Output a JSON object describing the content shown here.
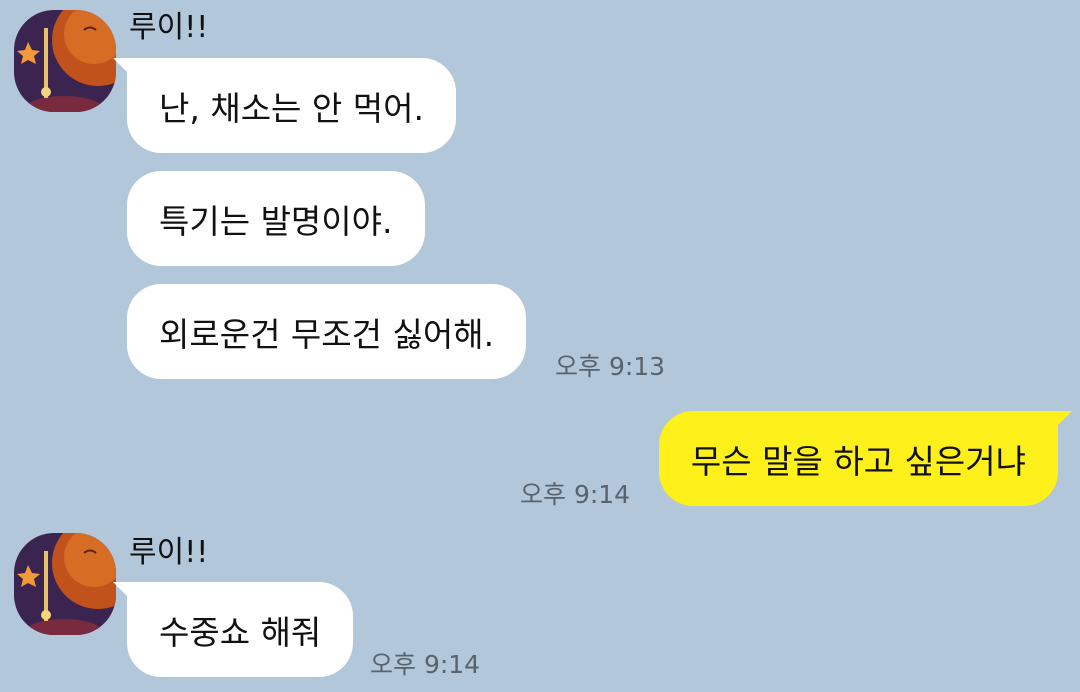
{
  "chat": {
    "messages": [
      {
        "sender": "루이!!",
        "bubbles": [
          "난, 채소는 안 먹어.",
          "특기는 발명이야.",
          "외로운건 무조건 싫어해."
        ],
        "time": "오후 9:13"
      },
      {
        "outgoing": true,
        "bubbles": [
          "무슨 말을 하고 싶은거냐"
        ],
        "time": "오후 9:14"
      },
      {
        "sender": "루이!!",
        "bubbles": [
          "수중쇼 해줘"
        ],
        "time": "오후 9:14"
      }
    ]
  },
  "colors": {
    "background": "#b2c7d9",
    "incoming_bubble": "#ffffff",
    "outgoing_bubble": "#fef01b",
    "timestamp": "#58636e"
  }
}
